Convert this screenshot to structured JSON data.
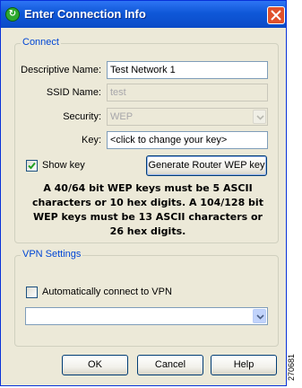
{
  "window": {
    "title": "Enter Connection Info"
  },
  "connect": {
    "legend": "Connect",
    "descriptive_name": {
      "label": "Descriptive Name:",
      "value": "Test Network 1"
    },
    "ssid_name": {
      "label": "SSID Name:",
      "value": "test"
    },
    "security": {
      "label": "Security:",
      "value": "WEP"
    },
    "key": {
      "label": "Key:",
      "value": "<click to change your key>"
    },
    "show_key": {
      "label": "Show key",
      "checked": true
    },
    "generate_button": "Generate Router WEP key",
    "note": "A 40/64 bit WEP keys must be 5 ASCII characters or 10 hex digits. A 104/128 bit WEP keys must be 13 ASCII characters or 26 hex digits."
  },
  "vpn": {
    "legend": "VPN Settings",
    "auto_connect": {
      "label": "Automatically connect to VPN",
      "checked": false
    },
    "vpn_select_value": ""
  },
  "buttons": {
    "ok": "OK",
    "cancel": "Cancel",
    "help": "Help"
  },
  "figure_id": "270681",
  "colors": {
    "titlebar": "#0f58d8",
    "dialog_bg": "#ece9d8",
    "legend_text": "#0046d5",
    "close_button": "#e0512c"
  }
}
